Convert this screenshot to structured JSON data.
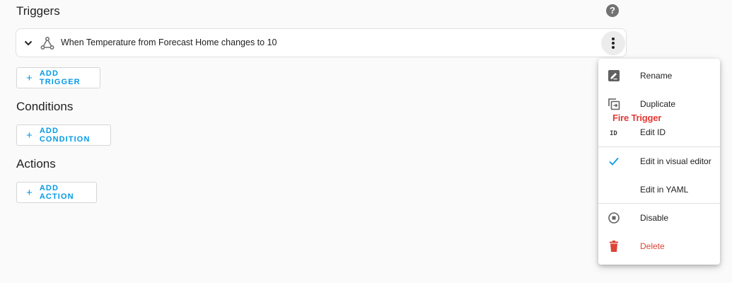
{
  "sections": {
    "triggers_title": "Triggers",
    "conditions_title": "Conditions",
    "actions_title": "Actions"
  },
  "help": {
    "glyph": "?"
  },
  "trigger": {
    "label": "When Temperature from Forecast Home changes to 10",
    "icon": "hub-icon",
    "expand_icon": "chevron-down-icon"
  },
  "buttons": {
    "add_trigger": "ADD TRIGGER",
    "add_condition": "ADD CONDITION",
    "add_action": "ADD ACTION",
    "plus": "+"
  },
  "menu": {
    "items": [
      {
        "label": "Rename",
        "icon": "rename-icon"
      },
      {
        "label": "Duplicate",
        "icon": "duplicate-icon"
      },
      {
        "label": "Edit ID",
        "icon": "id-icon"
      },
      {
        "label": "Edit in visual editor",
        "icon": "check-icon",
        "checked": true
      },
      {
        "label": "Edit in YAML",
        "icon": ""
      },
      {
        "label": "Disable",
        "icon": "disable-icon"
      },
      {
        "label": "Delete",
        "icon": "delete-icon",
        "danger": true
      }
    ]
  },
  "tooltip": {
    "text": "Fire Trigger"
  },
  "colors": {
    "accent": "#039be5",
    "danger": "#db4437",
    "check": "#039be5",
    "tooltip_text": "#e53935"
  }
}
